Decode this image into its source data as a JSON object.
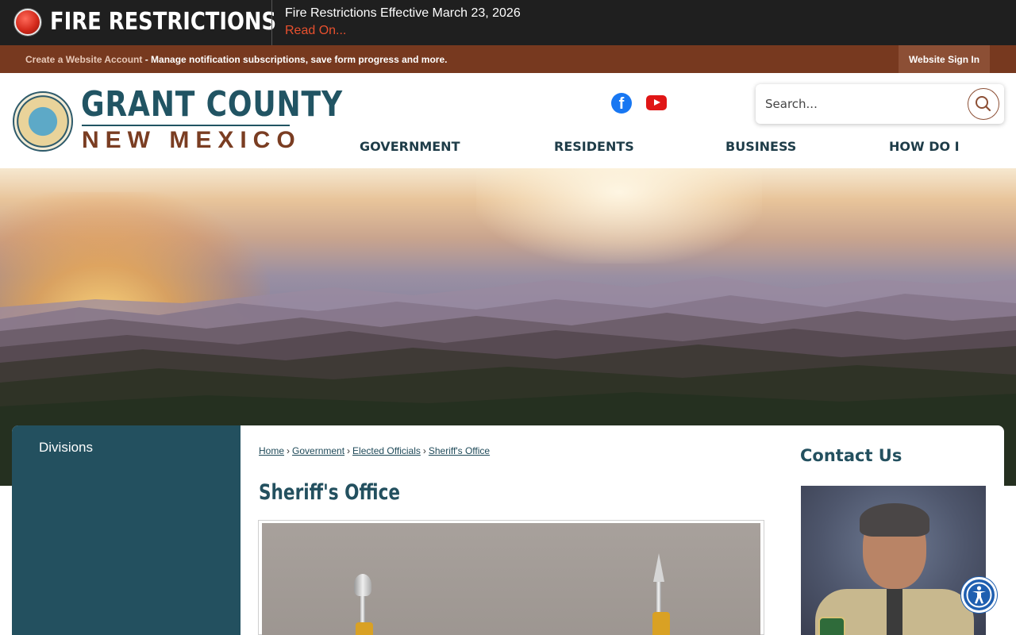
{
  "alert": {
    "icon": "red-alert-dot-icon",
    "title": "FIRE RESTRICTIONS",
    "headline": "Fire Restrictions Effective March 23, 2026",
    "read_on": "Read On..."
  },
  "account_bar": {
    "create_link": "Create a Website Account",
    "description": " - Manage notification subscriptions, save form progress and more.",
    "sign_in": "Website Sign In"
  },
  "logo": {
    "line1": "GRANT COUNTY",
    "line2": "NEW MEXICO"
  },
  "social": {
    "facebook": "f"
  },
  "search": {
    "placeholder": "Search..."
  },
  "nav": {
    "items": [
      "GOVERNMENT",
      "RESIDENTS",
      "BUSINESS",
      "HOW DO I"
    ]
  },
  "sidebar": {
    "items": [
      "Divisions"
    ]
  },
  "breadcrumb": {
    "items": [
      "Home",
      "Government",
      "Elected Officials",
      "Sheriff's Office"
    ],
    "separator": "›"
  },
  "page": {
    "title": "Sheriff's Office"
  },
  "contact": {
    "title": "Contact Us"
  },
  "colors": {
    "alert_bg": "#1f1f1f",
    "account_bar": "#77391f",
    "brand_teal": "#23505f",
    "brand_brown": "#7a3d22",
    "read_on": "#e8502e"
  }
}
